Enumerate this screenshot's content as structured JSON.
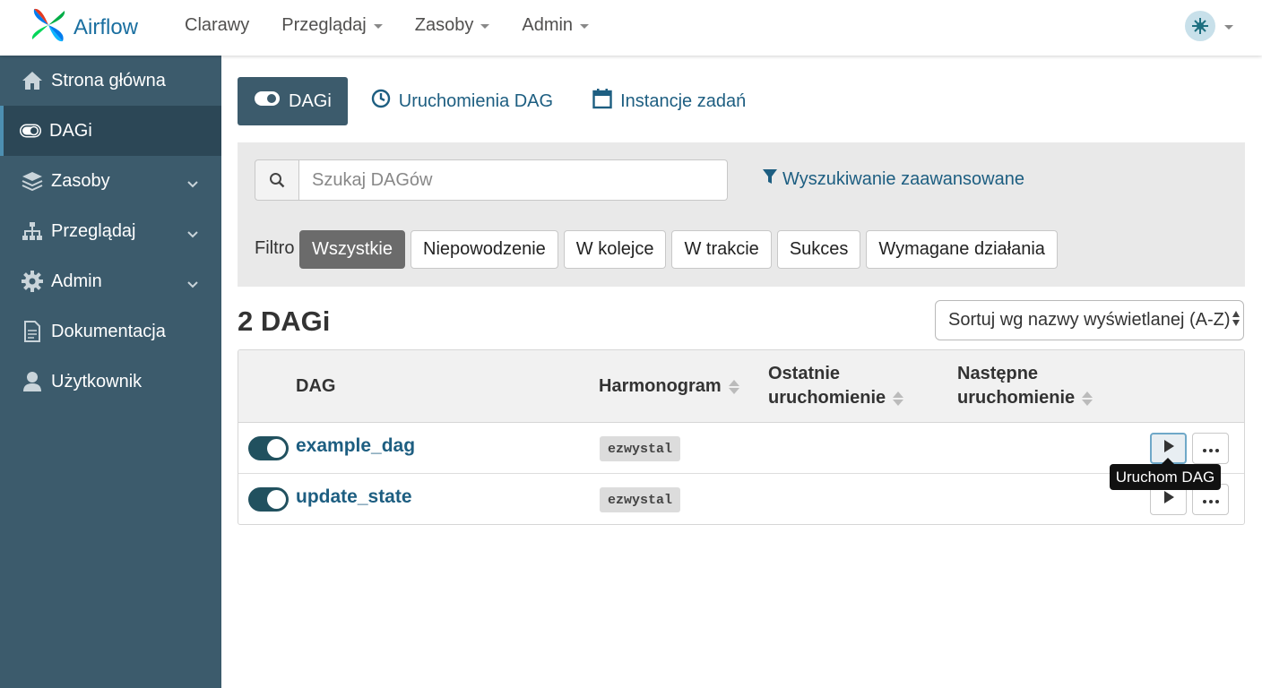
{
  "navbar": {
    "brand": "Airflow",
    "items": [
      {
        "label": "Clarawy"
      },
      {
        "label": "Przeglądaj"
      },
      {
        "label": "Zasoby"
      },
      {
        "label": "Admin"
      }
    ],
    "avatar_icon": "user-avatar-icon"
  },
  "sidebar": {
    "items": [
      {
        "label": "Strona główna",
        "icon": "home-icon",
        "active": false
      },
      {
        "label": "DAGi",
        "icon": "toggle-icon",
        "active": true
      },
      {
        "label": "Zasoby",
        "icon": "layers-icon",
        "expandable": true
      },
      {
        "label": "Przeglądaj",
        "icon": "sitemap-icon",
        "expandable": true
      },
      {
        "label": "Admin",
        "icon": "gear-icon",
        "expandable": true
      },
      {
        "label": "Dokumentacja",
        "icon": "document-icon"
      },
      {
        "label": "Użytkownik",
        "icon": "user-icon"
      }
    ]
  },
  "tabs": [
    {
      "label": "DAGi",
      "icon": "toggle-icon",
      "active": true
    },
    {
      "label": "Uruchomienia DAG",
      "icon": "clock-icon"
    },
    {
      "label": "Instancje zadań",
      "icon": "calendar-icon"
    }
  ],
  "search": {
    "placeholder": "Szukaj DAGów",
    "value": "",
    "advanced_label": "Wyszukiwanie zaawansowane"
  },
  "filters": {
    "label": "Filtro",
    "buttons": [
      {
        "label": "Wszystkie",
        "active": true
      },
      {
        "label": "Niepowodzenie"
      },
      {
        "label": "W kolejce"
      },
      {
        "label": "W trakcie"
      },
      {
        "label": "Sukces"
      },
      {
        "label": "Wymagane działania"
      }
    ]
  },
  "list": {
    "count_title": "2 DAGi",
    "sort_selected": "Sortuj wg nazwy wyświetlanej (A-Z)",
    "columns": [
      {
        "label": "DAG"
      },
      {
        "label": "Harmonogram",
        "sortable": true
      },
      {
        "label_line1": "Ostatnie",
        "label_line2": "uruchomienie",
        "sortable": true
      },
      {
        "label_line1": "Następne",
        "label_line2": "uruchomienie",
        "sortable": true
      }
    ],
    "rows": [
      {
        "name": "example_dag",
        "schedule": "ezwystal",
        "enabled": true
      },
      {
        "name": "update_state",
        "schedule": "ezwystal",
        "enabled": true
      }
    ]
  },
  "tooltip": {
    "text": "Uruchom DAG"
  },
  "colors": {
    "sidebar": "#3c5b6c",
    "link": "#1d5e81",
    "toggle": "#21515f"
  }
}
